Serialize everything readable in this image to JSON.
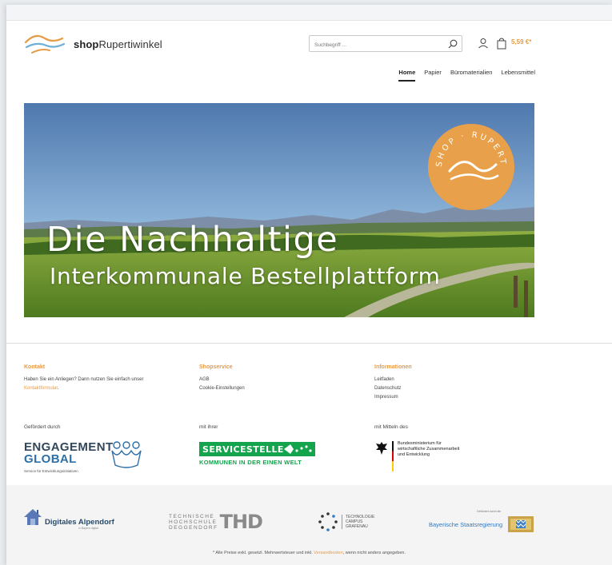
{
  "header": {
    "logo_bold": "shop",
    "logo_rest": "Rupertiwinkel",
    "search_placeholder": "Suchbegriff ...",
    "cart_total": "5,59 €*"
  },
  "nav": {
    "items": [
      "Home",
      "Papier",
      "Büromaterialien",
      "Lebensmittel"
    ],
    "active": "Home"
  },
  "hero": {
    "title": "Die Nachhaltige",
    "subtitle": "Interkommunale Bestellplattform",
    "badge_text": "SHOP · RUPERTIWINKEL"
  },
  "footer": {
    "contact": {
      "heading": "Kontakt",
      "text": "Haben Sie ein Anliegen? Dann nutzen Sie einfach unser",
      "link": "Kontaktformular",
      "link_suffix": "."
    },
    "shopservice": {
      "heading": "Shopservice",
      "links": [
        "AGB",
        "Cookie-Einstellungen"
      ]
    },
    "informationen": {
      "heading": "Informationen",
      "links": [
        "Leitfaden",
        "Datenschutz",
        "Impressum"
      ]
    }
  },
  "sponsors": {
    "label_1": "Gefördert durch",
    "label_2": "mit ihrer",
    "label_3": "mit Mitteln des",
    "engagement_line1": "ENGAGEMENT",
    "engagement_line2": "GLOBAL",
    "engagement_small": "Service für Entwicklungsinitiativen",
    "servicestelle": "SERVICESTELLE",
    "servicestelle_sub": "KOMMUNEN IN DER EINEN WELT",
    "bmz_lines": [
      "Bundesministerium für",
      "wirtschaftliche Zusammenarbeit",
      "und Entwicklung"
    ]
  },
  "partners": {
    "alpendorf": "Digitales Alpendorf",
    "alpendorf_small": "in Bayern digital",
    "thd_lines": [
      "TECHNISCHE",
      "HOCHSCHULE",
      "DEGGENDORF"
    ],
    "thd_mark": "THD",
    "campus_lines": [
      "TECHNOLOGIE",
      "CAMPUS",
      "GRAFENAU"
    ],
    "bayern_small": "Gefördert durch die",
    "bayern": "Bayerische Staatsregierung"
  },
  "footnote": {
    "prefix": "* Alle Preise exkl. gesetzl. Mehrwertsteuer und inkl. ",
    "link": "Versandkosten",
    "suffix": ", wenn nicht anders angegeben."
  },
  "colors": {
    "accent": "#e79b46",
    "green": "#14a44d",
    "blue": "#2f7bc4"
  }
}
